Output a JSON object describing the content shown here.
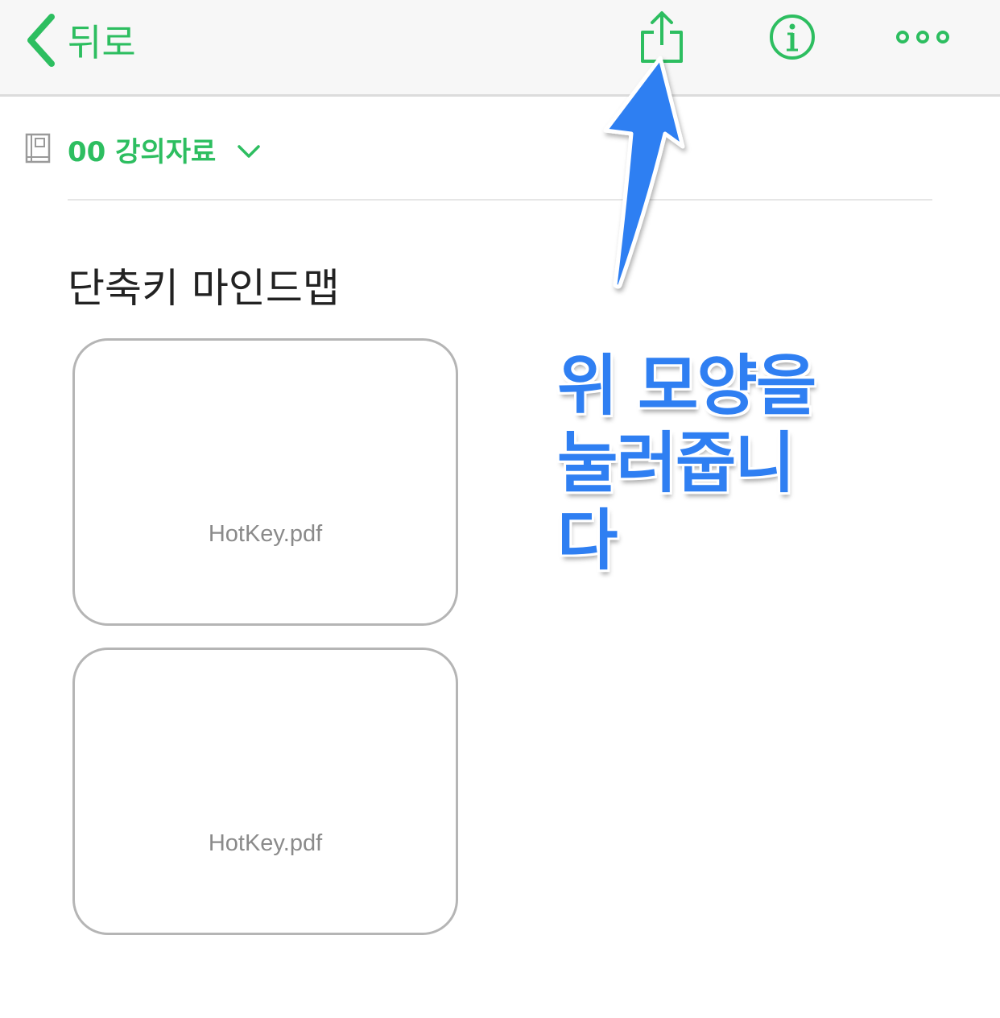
{
  "navbar": {
    "back_label": "뒤로",
    "icons": [
      "chevron-left-icon",
      "share-icon",
      "info-icon",
      "more-icon"
    ],
    "accent_color": "#2dbe60"
  },
  "notebook": {
    "name": "00 강의자료",
    "icon": "notebook-icon"
  },
  "note": {
    "title": "단축키 마인드맵",
    "attachments": [
      {
        "filename": "HotKey.pdf"
      },
      {
        "filename": "HotKey.pdf"
      }
    ]
  },
  "annotation": {
    "lines": [
      "위 모양을",
      "눌러줍니",
      "다"
    ],
    "color": "#2f7ff2",
    "arrow_icon": "arrow-up-icon"
  }
}
